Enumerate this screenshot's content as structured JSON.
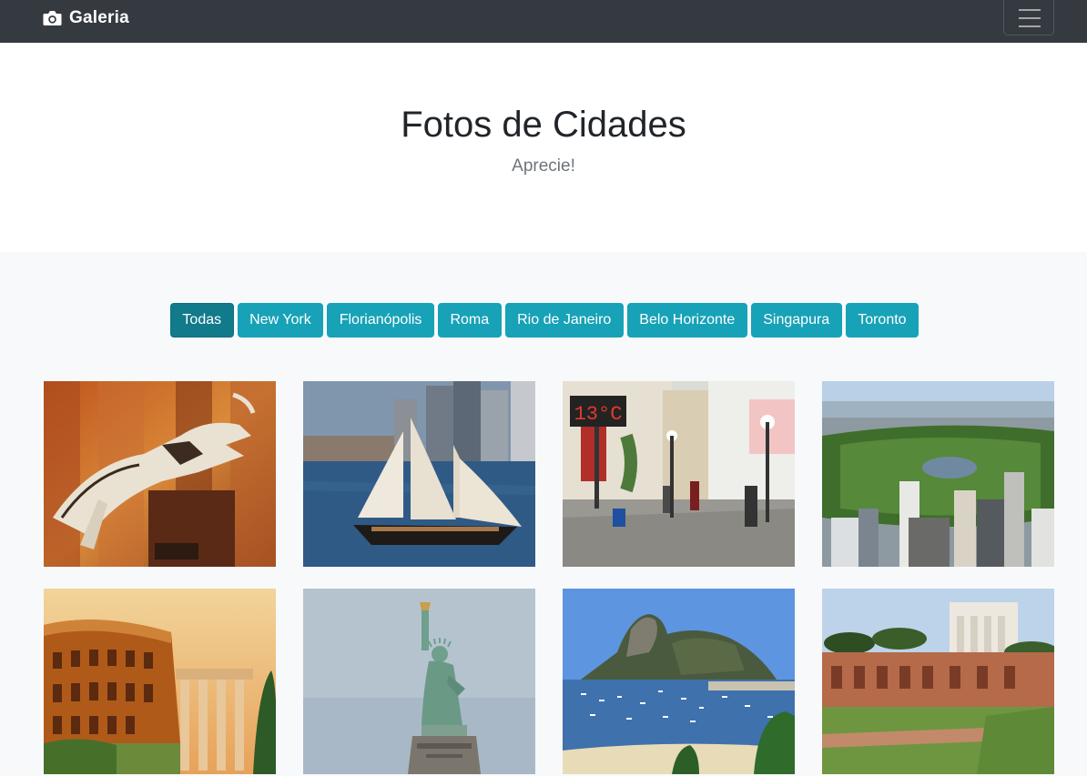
{
  "navbar": {
    "brand_icon": "camera-icon",
    "brand_text": "Galeria",
    "toggler_icon": "hamburger-menu-icon"
  },
  "hero": {
    "title": "Fotos de Cidades",
    "subtitle": "Aprecie!"
  },
  "filters": {
    "items": [
      {
        "label": "Todas",
        "active": true
      },
      {
        "label": "New York",
        "active": false
      },
      {
        "label": "Florianópolis",
        "active": false
      },
      {
        "label": "Roma",
        "active": false
      },
      {
        "label": "Rio de Janeiro",
        "active": false
      },
      {
        "label": "Belo Horizonte",
        "active": false
      },
      {
        "label": "Singapura",
        "active": false
      },
      {
        "label": "Toronto",
        "active": false
      }
    ]
  },
  "photos": [
    {
      "subject": "dinosaur-skeleton"
    },
    {
      "subject": "sailboat-skyline"
    },
    {
      "subject": "street-thermometer",
      "sign_text": "13°C"
    },
    {
      "subject": "central-park-aerial"
    },
    {
      "subject": "colosseum"
    },
    {
      "subject": "statue-of-liberty"
    },
    {
      "subject": "sugarloaf-mountain"
    },
    {
      "subject": "roman-forum"
    }
  ],
  "colors": {
    "navbar_bg": "#343a40",
    "filter_button": "#17a2b8",
    "filter_button_active": "#117a8b",
    "section_bg": "#f8f9fa"
  }
}
